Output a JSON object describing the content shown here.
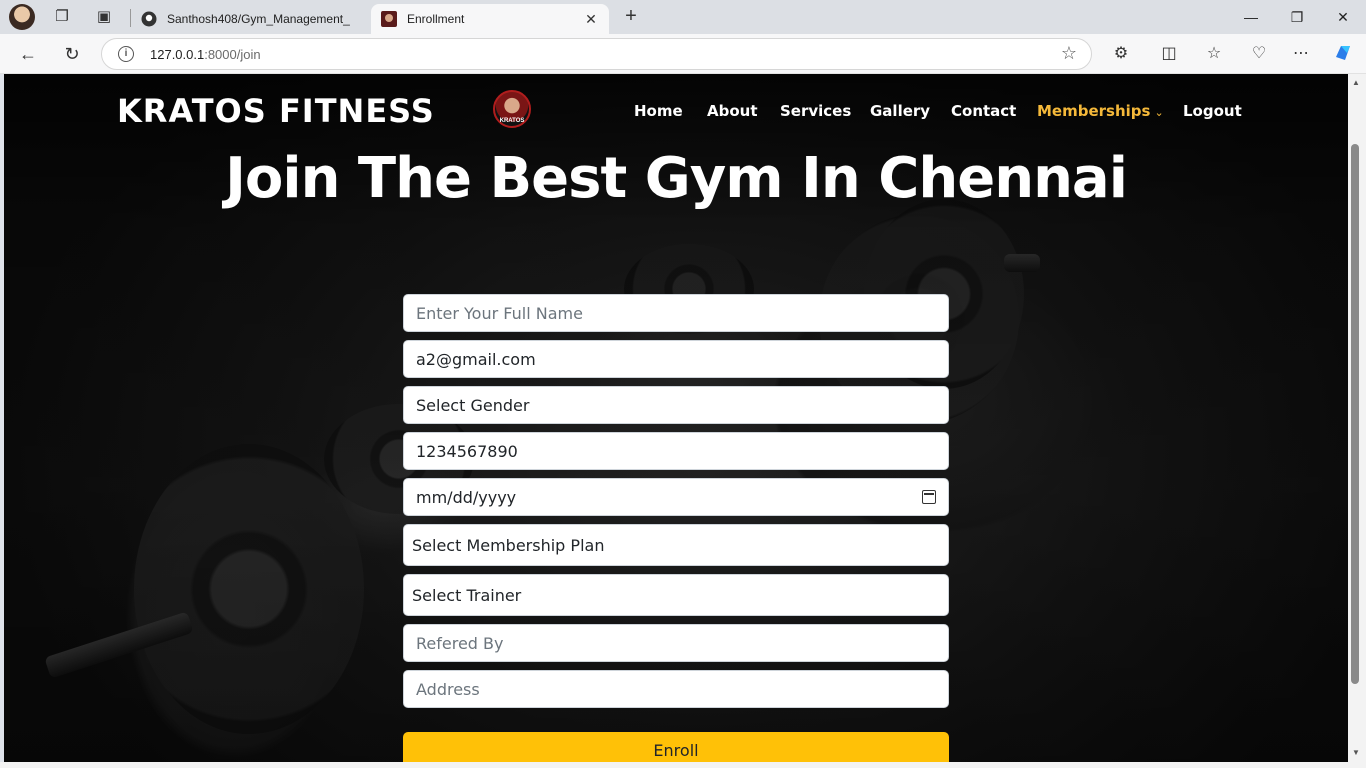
{
  "browser": {
    "tabs": [
      {
        "title": "Santhosh408/Gym_Management_",
        "icon": "github-icon"
      },
      {
        "title": "Enrollment",
        "icon": "kratos-favicon",
        "active": true
      }
    ],
    "url_host": "127.0.0.1",
    "url_rest": ":8000/join"
  },
  "site": {
    "brand": "KRATOS FITNESS",
    "logo_text": "KRATOS",
    "nav": [
      {
        "label": "Home"
      },
      {
        "label": "About"
      },
      {
        "label": "Services"
      },
      {
        "label": "Gallery"
      },
      {
        "label": "Contact"
      },
      {
        "label": "Memberships",
        "active": true
      },
      {
        "label": "Logout"
      }
    ],
    "accent_color": "#f5b93a"
  },
  "hero": {
    "title": "Join The Best Gym In Chennai"
  },
  "form": {
    "full_name_placeholder": "Enter Your Full Name",
    "email_value": "a2@gmail.com",
    "gender_selected": "Select Gender",
    "phone_value": "1234567890",
    "dob_placeholder": "mm/dd/yyyy",
    "membership_selected": "Select Membership Plan",
    "trainer_selected": "Select Trainer",
    "referred_placeholder": "Refered By",
    "address_placeholder": "Address",
    "submit_label": "Enroll",
    "submit_color": "#ffc107"
  }
}
